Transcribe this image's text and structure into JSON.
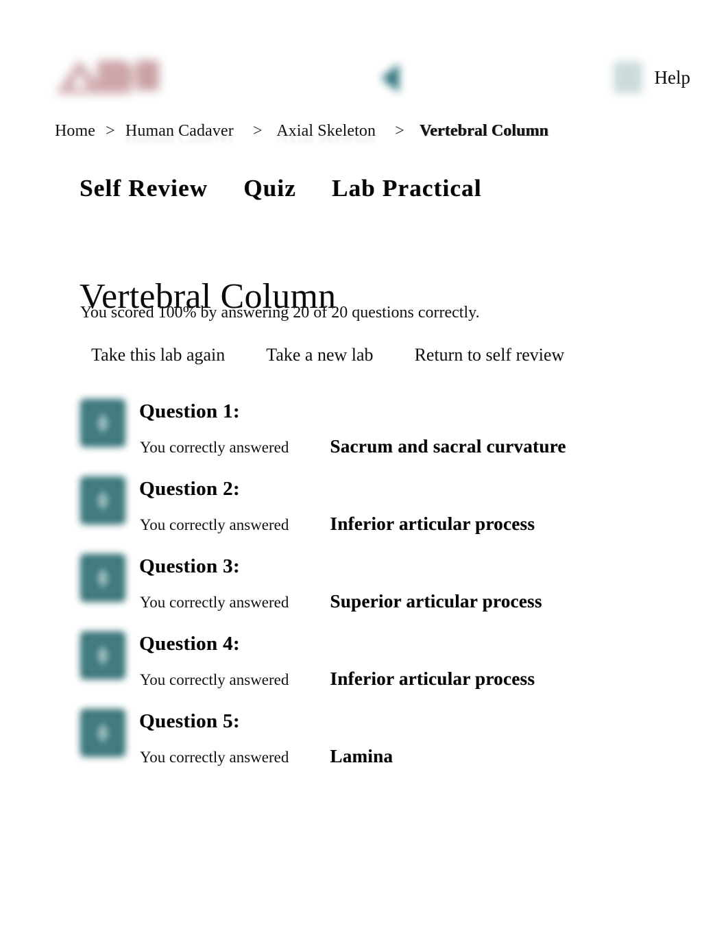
{
  "topbar": {
    "logo_alt": "PAL logo",
    "back_icon": "back-arrow-icon",
    "help_icon": "help-icon",
    "help_label": "Help"
  },
  "breadcrumb": {
    "separator": ">",
    "items": [
      {
        "label": "Home",
        "current": false
      },
      {
        "label": "Human Cadaver",
        "current": false
      },
      {
        "label": "Axial Skeleton",
        "current": false
      },
      {
        "label": "Vertebral Column",
        "current": true
      }
    ]
  },
  "tabs": [
    {
      "label": "Self Review"
    },
    {
      "label": "Quiz"
    },
    {
      "label": "Lab Practical"
    }
  ],
  "main": {
    "title": "Vertebral Column",
    "score_text": "You scored 100% by answering 20 of 20 questions correctly.",
    "score_percent": "100%",
    "correct_count": "20",
    "total_count": "20",
    "actions": [
      {
        "label": "Take this lab again"
      },
      {
        "label": "Take a new lab"
      },
      {
        "label": "Return to self review"
      }
    ],
    "answer_prefix": "You correctly answered",
    "questions": [
      {
        "label": "Question 1:",
        "prefix": "You correctly answered",
        "answer": "Sacrum and sacral curvature",
        "icon": "correct-answer-icon"
      },
      {
        "label": "Question 2:",
        "prefix": "You correctly answered",
        "answer": "Inferior articular process",
        "icon": "correct-answer-icon"
      },
      {
        "label": "Question 3:",
        "prefix": "You correctly answered",
        "answer": "Superior articular process",
        "icon": "correct-answer-icon"
      },
      {
        "label": "Question 4:",
        "prefix": "You correctly answered",
        "answer": "Inferior articular process",
        "icon": "correct-answer-icon"
      },
      {
        "label": "Question 5:",
        "prefix": "You correctly answered",
        "answer": "Lamina",
        "icon": "correct-answer-icon"
      }
    ]
  },
  "colors": {
    "accent_teal": "#2a6b70",
    "logo_maroon": "#9a5258",
    "help_icon": "#c3d4d4",
    "page_background": "#ffffff",
    "text": "#111111"
  }
}
